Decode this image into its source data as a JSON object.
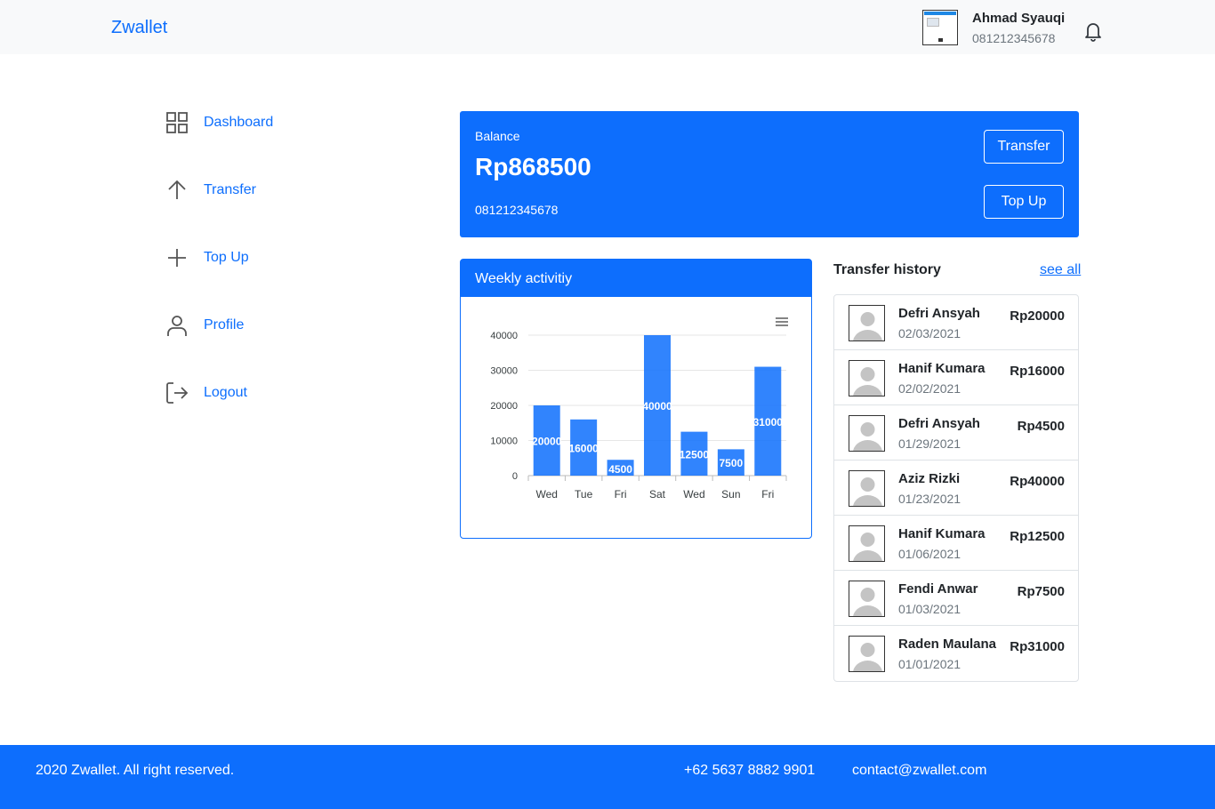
{
  "brand": "Zwallet",
  "user": {
    "name": "Ahmad Syauqi",
    "phone": "081212345678"
  },
  "sidebar": {
    "items": [
      {
        "label": "Dashboard",
        "icon": "grid-icon"
      },
      {
        "label": "Transfer",
        "icon": "arrow-up-icon"
      },
      {
        "label": "Top Up",
        "icon": "plus-icon"
      },
      {
        "label": "Profile",
        "icon": "user-icon"
      },
      {
        "label": "Logout",
        "icon": "logout-icon"
      }
    ]
  },
  "balance": {
    "label": "Balance",
    "amount": "Rp868500",
    "phone": "081212345678",
    "transfer_label": "Transfer",
    "topup_label": "Top Up"
  },
  "activity": {
    "title": "Weekly activitiy",
    "menu_icon": "hamburger-menu-icon"
  },
  "chart_data": {
    "type": "bar",
    "categories": [
      "Wed",
      "Tue",
      "Fri",
      "Sat",
      "Wed",
      "Sun",
      "Fri"
    ],
    "values": [
      20000,
      16000,
      4500,
      40000,
      12500,
      7500,
      31000
    ],
    "ylim": [
      0,
      40000
    ],
    "yticks": [
      0,
      10000,
      20000,
      30000,
      40000
    ],
    "grid": true,
    "data_labels": true,
    "color": "#0d6efd"
  },
  "history": {
    "title": "Transfer history",
    "see_all": "see all",
    "items": [
      {
        "name": "Defri Ansyah",
        "date": "02/03/2021",
        "amount": "Rp20000"
      },
      {
        "name": "Hanif Kumara",
        "date": "02/02/2021",
        "amount": "Rp16000"
      },
      {
        "name": "Defri Ansyah",
        "date": "01/29/2021",
        "amount": "Rp4500"
      },
      {
        "name": "Aziz Rizki",
        "date": "01/23/2021",
        "amount": "Rp40000"
      },
      {
        "name": "Hanif Kumara",
        "date": "01/06/2021",
        "amount": "Rp12500"
      },
      {
        "name": "Fendi Anwar",
        "date": "01/03/2021",
        "amount": "Rp7500"
      },
      {
        "name": "Raden Maulana",
        "date": "01/01/2021",
        "amount": "Rp31000"
      }
    ]
  },
  "footer": {
    "copyright": "2020 Zwallet. All right reserved.",
    "phone": "+62 5637 8882 9901",
    "email": "contact@zwallet.com"
  },
  "colors": {
    "primary": "#0d6efd",
    "topbar": "#f8f9fa",
    "muted": "#6c757d"
  }
}
